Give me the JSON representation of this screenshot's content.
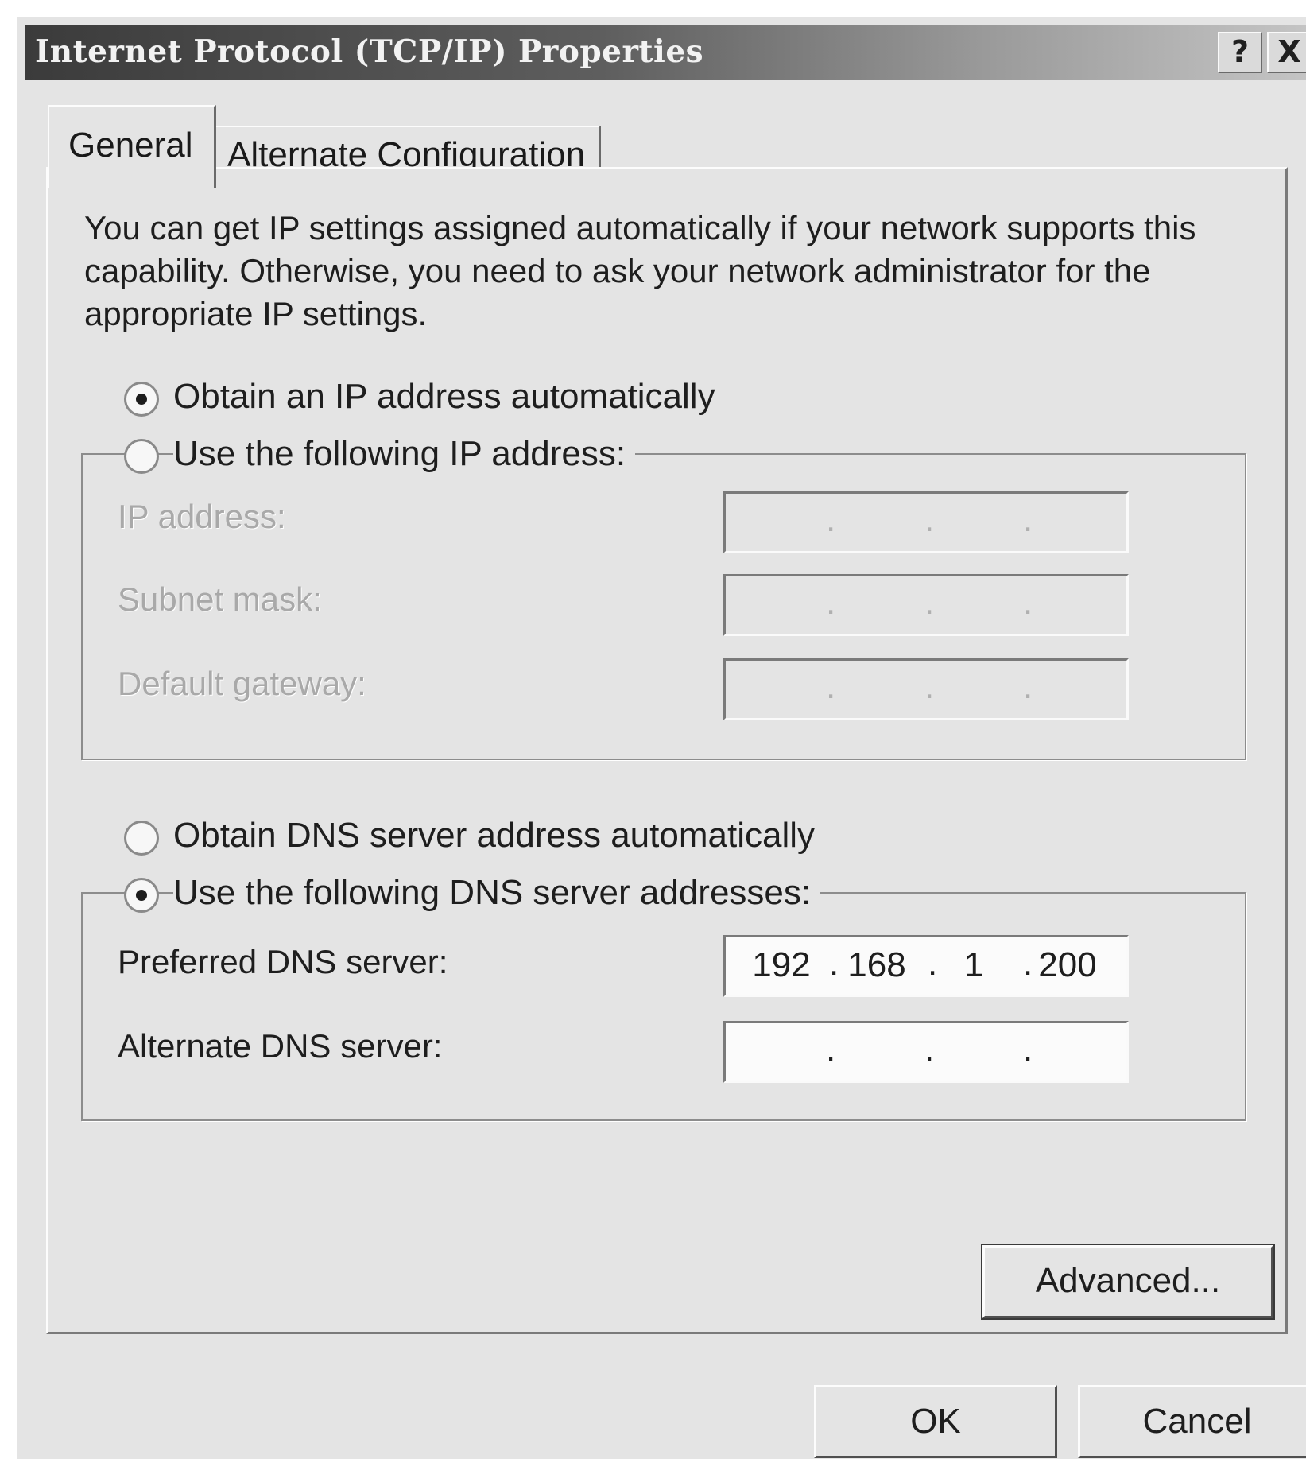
{
  "window": {
    "title": "Internet Protocol (TCP/IP) Properties",
    "help_label": "?",
    "close_label": "X"
  },
  "tabs": [
    {
      "label": "General",
      "active": true
    },
    {
      "label": "Alternate Configuration",
      "active": false
    }
  ],
  "general": {
    "description": "You can get IP settings assigned automatically if your network supports this capability. Otherwise, you need to ask your network administrator for the appropriate IP settings.",
    "ip_mode": {
      "auto_label": "Obtain an IP address automatically",
      "manual_label": "Use the following IP address:",
      "selected": "auto"
    },
    "ip_fields": {
      "ip_address": {
        "label": "IP address:",
        "octets": [
          "",
          "",
          "",
          ""
        ]
      },
      "subnet_mask": {
        "label": "Subnet mask:",
        "octets": [
          "",
          "",
          "",
          ""
        ]
      },
      "default_gateway": {
        "label": "Default gateway:",
        "octets": [
          "",
          "",
          "",
          ""
        ]
      }
    },
    "dns_mode": {
      "auto_label": "Obtain DNS server address automatically",
      "manual_label": "Use the following DNS server addresses:",
      "selected": "manual"
    },
    "dns_fields": {
      "preferred": {
        "label": "Preferred DNS server:",
        "octets": [
          "192",
          "168",
          "1",
          "200"
        ]
      },
      "alternate": {
        "label": "Alternate DNS server:",
        "octets": [
          "",
          "",
          "",
          ""
        ]
      }
    },
    "advanced_label": "Advanced..."
  },
  "buttons": {
    "ok_label": "OK",
    "cancel_label": "Cancel"
  }
}
